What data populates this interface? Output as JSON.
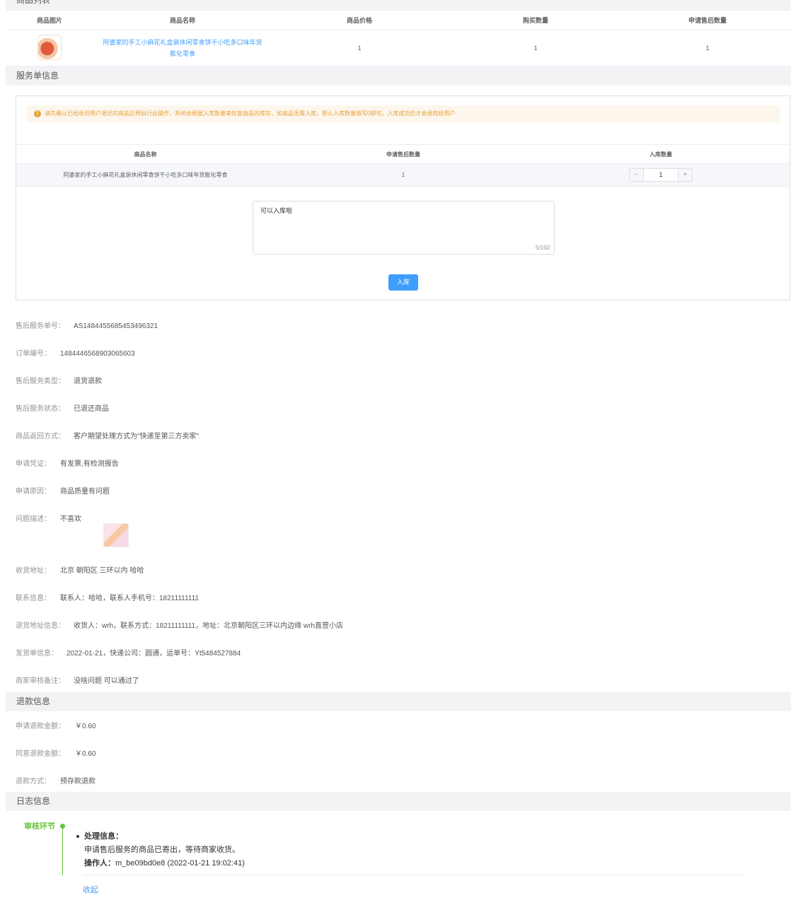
{
  "sections": {
    "product_list": "商品列表",
    "service_info": "服务单信息",
    "refund_info": "退款信息",
    "log_info": "日志信息"
  },
  "product_table": {
    "headers": [
      "商品图片",
      "商品名称",
      "商品价格",
      "购买数量",
      "申请售后数量"
    ],
    "row": {
      "name": "阿婆家的手工小麻花礼盒装休闲零食饼干小吃多口味年货膨化零食",
      "price": "1",
      "buy_qty": "1",
      "apply_qty": "1"
    }
  },
  "store_box": {
    "warning": "请先确认已经收到用户退还的商品后再执行此操作，系统会根据入库数量来恢复商品的库存，如商品无需入库，那么入库数量填写0即可，入库成功后才会退款给用户",
    "headers": [
      "商品名称",
      "申请售后数量",
      "入库数量"
    ],
    "row": {
      "name": "阿婆家的手工小麻花礼盒装休闲零食饼干小吃多口味年货膨化零食",
      "apply_qty": "1",
      "store_qty": "1"
    },
    "remark": "可以入库啦",
    "counter": "5/150",
    "button": "入库"
  },
  "info": [
    {
      "label": "售后服务单号：",
      "value": "AS1484455685453496321"
    },
    {
      "label": "订单编号：",
      "value": "1484446568903065603"
    },
    {
      "label": "售后服务类型：",
      "value": "退货退款"
    },
    {
      "label": "售后服务状态：",
      "value": "已退还商品"
    },
    {
      "label": "商品返回方式：",
      "value": "客户期望处理方式为\"快递至第三方卖家\""
    },
    {
      "label": "申请凭证：",
      "value": "有发票,有检测报告"
    },
    {
      "label": "申请原因：",
      "value": "商品质量有问题"
    },
    {
      "label": "问题描述：",
      "value": "不喜欢"
    },
    {
      "label": "收货地址：",
      "value": "北京 朝阳区 三环以内 哈哈"
    },
    {
      "label": "联系信息：",
      "value": "联系人：哈哈，联系人手机号：18211111111"
    },
    {
      "label": "退货地址信息：",
      "value": "收货人：wrh，联系方式：18211111111，地址：北京朝阳区三环以内边缘 wrh直营小店"
    },
    {
      "label": "发货单信息：",
      "value": "2022-01-21，快递公司：圆通，运单号：Yt5484527884"
    },
    {
      "label": "商家审核备注：",
      "value": "没啥问题 可以通过了"
    }
  ],
  "refund": [
    {
      "label": "申请退款金额：",
      "value": "￥0.60"
    },
    {
      "label": "同意退款金额：",
      "value": "￥0.60"
    },
    {
      "label": "退款方式：",
      "value": "预存款退款"
    }
  ],
  "log": {
    "stage": "审核环节",
    "title": "处理信息：",
    "message": "申请售后服务的商品已寄出，等待商家收货。",
    "operator_label": "操作人：",
    "operator": "m_be09bd0e8 (2022-01-21 19:02:41)",
    "collapse": "收起"
  }
}
